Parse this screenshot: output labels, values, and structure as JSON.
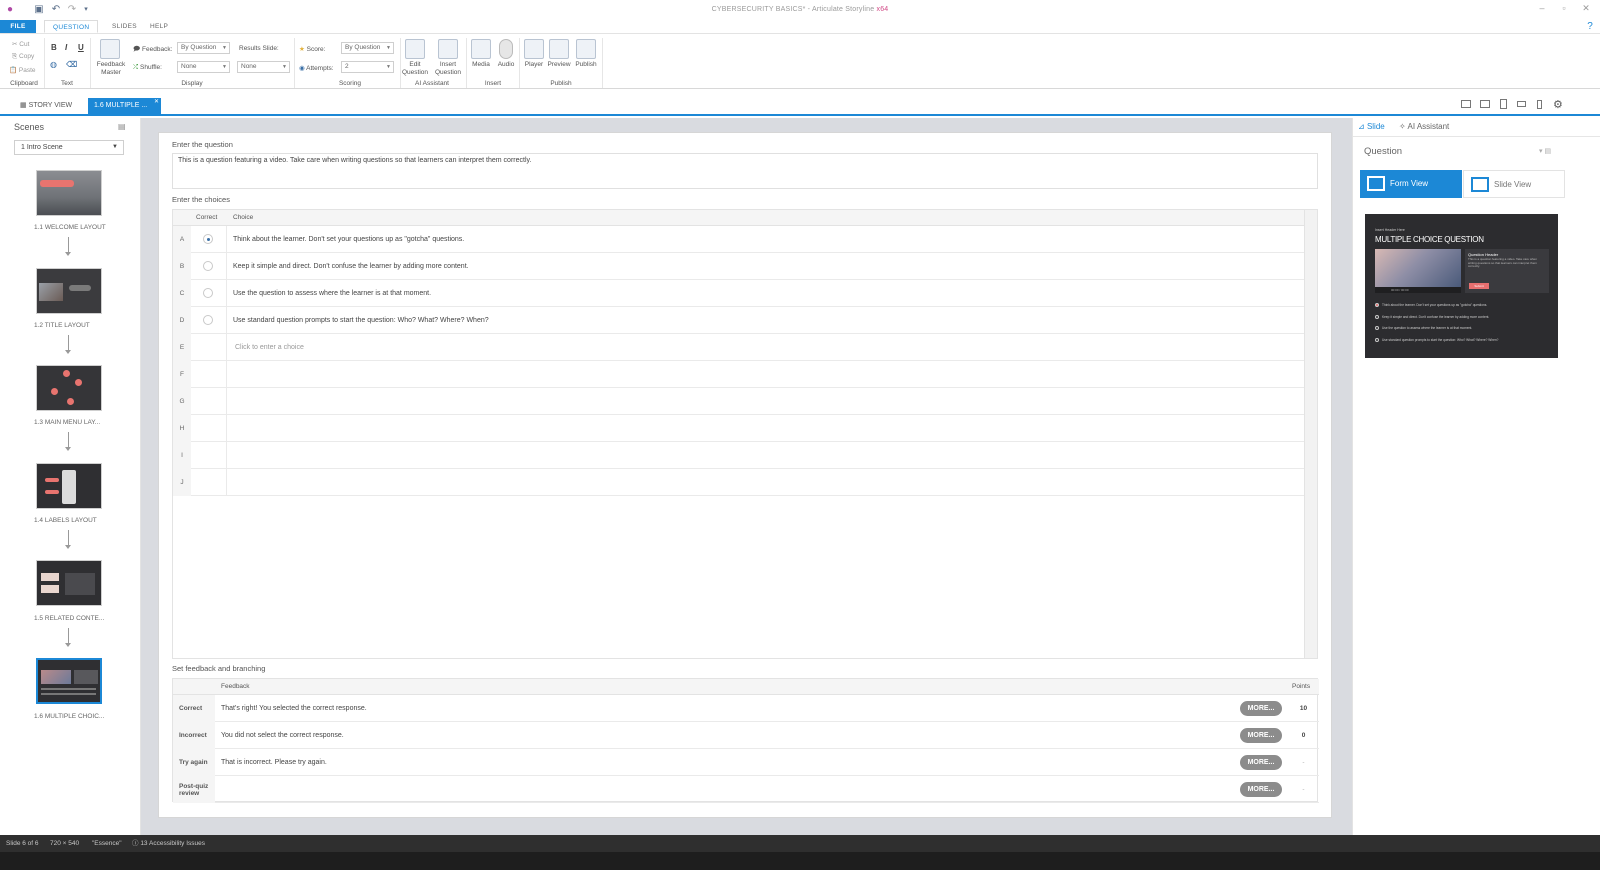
{
  "app": {
    "title_main": "CYBERSECURITY BASICS* - Articulate Storyline",
    "title_edition": "x64"
  },
  "menu": {
    "tabs": [
      "FILE",
      "QUESTION",
      "SLIDES",
      "HELP"
    ]
  },
  "ribbon": {
    "clipboard": {
      "cut": "Cut",
      "copy": "Copy",
      "paste": "Paste",
      "label": "Clipboard"
    },
    "text": {
      "bold": "B",
      "italic": "I",
      "underline": "U",
      "label": "Text"
    },
    "feedback_master": "Feedback Master",
    "display": {
      "feedback_label": "Feedback:",
      "feedback_value": "By Question",
      "results_slide_label": "Results Slide:",
      "results_slide_value": "None",
      "shuffle_label": "Shuffle:",
      "shuffle_value": "None",
      "label": "Display"
    },
    "scoring": {
      "score_label": "Score:",
      "score_value": "By Question",
      "attempts_label": "Attempts:",
      "attempts_value": "2",
      "label": "Scoring"
    },
    "ai_assistant": {
      "edit_question": "Edit Question",
      "insert_question": "Insert Question",
      "label": "AI Assistant"
    },
    "insert": {
      "media": "Media",
      "audio": "Audio",
      "label": "Insert"
    },
    "publish": {
      "player": "Player",
      "preview": "Preview",
      "publish": "Publish",
      "label": "Publish"
    }
  },
  "doc_tabs": {
    "story_view": "STORY VIEW",
    "active_tab": "1.6 MULTIPLE ..."
  },
  "scenes": {
    "title": "Scenes",
    "selected_scene": "1 Intro Scene",
    "slides": [
      {
        "label": "1.1 WELCOME LAYOUT"
      },
      {
        "label": "1.2 TITLE LAYOUT"
      },
      {
        "label": "1.3 MAIN MENU LAY..."
      },
      {
        "label": "1.4 LABELS LAYOUT"
      },
      {
        "label": "1.5 RELATED CONTE..."
      },
      {
        "label": "1.6 MULTIPLE CHOIC..."
      }
    ]
  },
  "form": {
    "question_label": "Enter the question",
    "question_text": "This is a question featuring a video. Take care when writing questions so that learners can interpret them correctly.",
    "choices_label": "Enter the choices",
    "col_correct": "Correct",
    "col_choice": "Choice",
    "choices": [
      {
        "letter": "A",
        "text": "Think about the learner. Don't set your questions up as \"gotcha\" questions.",
        "correct": true
      },
      {
        "letter": "B",
        "text": "Keep it simple and direct. Don't confuse the learner by adding more content.",
        "correct": false
      },
      {
        "letter": "C",
        "text": "Use the question to assess where the learner is at that moment.",
        "correct": false
      },
      {
        "letter": "D",
        "text": "Use standard question prompts to start the question: Who? What? Where? When?",
        "correct": false
      },
      {
        "letter": "E",
        "text": "",
        "correct": false
      },
      {
        "letter": "F",
        "text": "",
        "correct": false
      },
      {
        "letter": "G",
        "text": "",
        "correct": false
      },
      {
        "letter": "H",
        "text": "",
        "correct": false
      },
      {
        "letter": "I",
        "text": "",
        "correct": false
      },
      {
        "letter": "J",
        "text": "",
        "correct": false
      }
    ],
    "choice_placeholder": "Click to enter a choice",
    "feedback_label": "Set feedback and branching",
    "col_feedback": "Feedback",
    "col_points": "Points",
    "feedback_rows": [
      {
        "label": "Correct",
        "text": "That's right!  You selected the correct response.",
        "more": "MORE...",
        "points": "10"
      },
      {
        "label": "Incorrect",
        "text": "You did not select the correct response.",
        "more": "MORE...",
        "points": "0"
      },
      {
        "label": "Try again",
        "text": "That is incorrect. Please try again.",
        "more": "MORE...",
        "points": "-"
      },
      {
        "label": "Post-quiz review",
        "text": "",
        "more": "MORE...",
        "points": "-"
      }
    ]
  },
  "right_panel": {
    "tab_slide": "Slide",
    "tab_ai": "AI Assistant",
    "section_title": "Question",
    "form_view": "Form View",
    "slide_view": "Slide View",
    "preview": {
      "kicker": "Insert Header Here",
      "title": "MULTIPLE CHOICE QUESTION",
      "side_title": "Question Header",
      "side_text": "This is a question featuring a video. Take care when writing questions so that learners can interpret them correctly.",
      "submit": "Submit",
      "video_label": "00:00 / 00:00",
      "options": [
        "Think about the learner. Don't set your questions up as \"gotcha\" questions.",
        "Keep it simple and direct. Don't confuse the learner by adding more content.",
        "Use the question to assess where the learner is at that moment.",
        "Use standard question prompts to start the question: Who? What? Where? When?"
      ]
    }
  },
  "status": {
    "slide": "Slide 6 of 6",
    "size": "720 × 540",
    "theme": "\"Essence\"",
    "accessibility": "13 Accessibility Issues"
  },
  "colors": {
    "accent": "#1c88d6",
    "status_bar": "#2f2f2f",
    "more_button": "#8c8c8c",
    "preview_button": "#e76f6f"
  }
}
